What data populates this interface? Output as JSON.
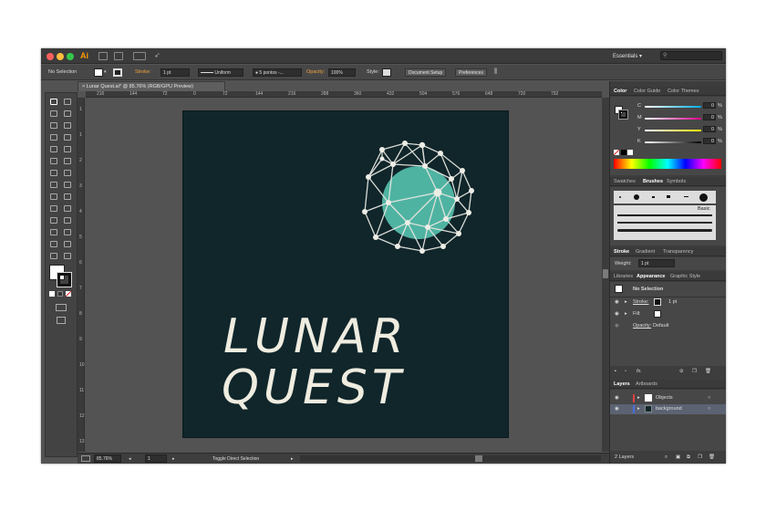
{
  "app": {
    "logo": "Ai",
    "workspace": "Essentials",
    "workspace_arrow": "▾"
  },
  "control_bar": {
    "selection": "No Selection",
    "stroke_label": "Stroke:",
    "stroke_weight": "1 pt",
    "profile": "Uniform",
    "brush": "5 pontos -...",
    "opacity_label": "Opacity:",
    "opacity_value": "100%",
    "style_label": "Style:",
    "document_setup": "Document Setup",
    "preferences": "Preferences"
  },
  "document": {
    "tab_title": "Lunar Quest.ai* @ 85.76% (RGB/GPU Preview)",
    "close": "×"
  },
  "ruler": {
    "h_ticks": [
      "216",
      "144",
      "72",
      "0",
      "72",
      "144",
      "216",
      "288",
      "360",
      "432",
      "504",
      "576",
      "648",
      "720",
      "792"
    ],
    "v_ticks": [
      "1",
      "1",
      "2",
      "3",
      "4",
      "5",
      "6",
      "7",
      "8",
      "9",
      "10",
      "11",
      "12",
      "13"
    ]
  },
  "artwork": {
    "line1": "LUNAR",
    "line2": "QUEST",
    "planet_color": "#4fb3a2",
    "text_color": "#efece0",
    "bg_color": "#10262b"
  },
  "status_bar": {
    "zoom": "85.76%",
    "artboard": "1",
    "tool_label": "Toggle Direct Selection"
  },
  "color_panel": {
    "tabs": [
      "Color",
      "Color Guide",
      "Color Themes"
    ],
    "channels": [
      {
        "label": "C",
        "value": "0",
        "unit": "%"
      },
      {
        "label": "M",
        "value": "0",
        "unit": "%"
      },
      {
        "label": "Y",
        "value": "0",
        "unit": "%"
      },
      {
        "label": "K",
        "value": "0",
        "unit": "%"
      }
    ]
  },
  "brush_panel": {
    "tabs": [
      "Swatches",
      "Brushes",
      "Symbols"
    ],
    "basic_label": "Basic"
  },
  "stroke_panel": {
    "tabs": [
      "Stroke",
      "Gradient",
      "Transparency"
    ],
    "weight_label": "Weight:",
    "weight_value": "1 pt"
  },
  "appearance_panel": {
    "tabs": [
      "Libraries",
      "Appearance",
      "Graphic Style"
    ],
    "selection": "No Selection",
    "stroke_label": "Stroke:",
    "stroke_value": "1 pt",
    "fill_label": "Fill:",
    "opacity_label": "Opacity:",
    "opacity_value": "Default",
    "fx": "fx."
  },
  "layers_panel": {
    "tabs": [
      "Layers",
      "Artboards"
    ],
    "layers": [
      {
        "name": "Objects",
        "color": "#e24040"
      },
      {
        "name": "background",
        "color": "#4a6fe0"
      }
    ],
    "count": "2 Layers"
  }
}
